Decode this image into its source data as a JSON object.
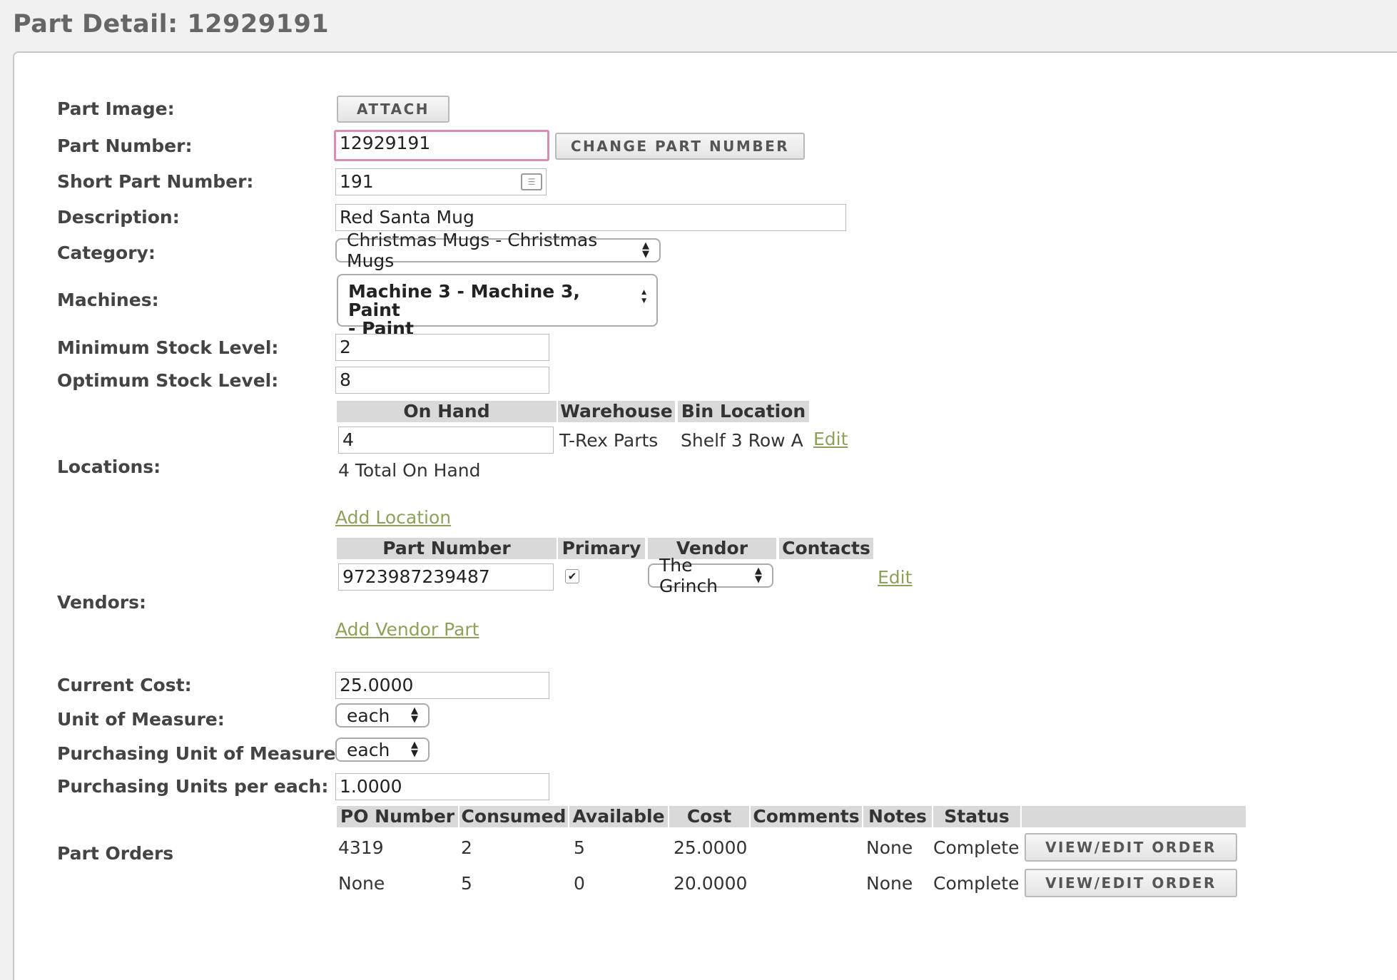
{
  "page_title": "Part Detail: 12929191",
  "labels": {
    "part_image": "Part Image:",
    "part_number": "Part Number:",
    "short_part_number": "Short Part Number:",
    "description": "Description:",
    "category": "Category:",
    "machines": "Machines:",
    "min_stock": "Minimum Stock Level:",
    "opt_stock": "Optimum Stock Level:",
    "locations": "Locations:",
    "vendors": "Vendors:",
    "current_cost": "Current Cost:",
    "unit_of_measure": "Unit of Measure:",
    "purchasing_unit": "Purchasing Unit of Measure:",
    "purchasing_units_per": "Purchasing Units per each:",
    "part_orders": "Part Orders"
  },
  "buttons": {
    "attach": "ATTACH",
    "change_part_number": "CHANGE PART NUMBER",
    "view_edit_order": "VIEW/EDIT ORDER"
  },
  "fields": {
    "part_number": "12929191",
    "short_part_number": "191",
    "description": "Red Santa Mug",
    "category": "Christmas Mugs - Christmas Mugs",
    "machines_line1": "Machine 3 - Machine 3, Paint",
    "machines_line2": "- Paint",
    "min_stock": "2",
    "opt_stock": "8",
    "current_cost": "25.0000",
    "unit_of_measure": "each",
    "purchasing_unit": "each",
    "purchasing_units_per": "1.0000"
  },
  "locations": {
    "headers": [
      "On Hand",
      "Warehouse",
      "Bin Location"
    ],
    "rows": [
      {
        "on_hand": "4",
        "warehouse": "T-Rex Parts",
        "bin": "Shelf 3 Row A",
        "edit": "Edit"
      }
    ],
    "total": "4 Total On Hand",
    "add_link": "Add Location"
  },
  "vendors": {
    "headers": [
      "Part Number",
      "Primary",
      "Vendor",
      "Contacts"
    ],
    "rows": [
      {
        "part_number": "9723987239487",
        "primary": true,
        "vendor": "The Grinch",
        "edit": "Edit"
      }
    ],
    "add_link": "Add Vendor Part"
  },
  "orders": {
    "headers": [
      "PO Number",
      "Consumed",
      "Available",
      "Cost",
      "Comments",
      "Notes",
      "Status"
    ],
    "rows": [
      {
        "po": "4319",
        "consumed": "2",
        "available": "5",
        "cost": "25.0000",
        "comments": "",
        "notes": "None",
        "status": "Complete"
      },
      {
        "po": "None",
        "consumed": "5",
        "available": "0",
        "cost": "20.0000",
        "comments": "",
        "notes": "None",
        "status": "Complete"
      }
    ]
  },
  "colors": {
    "link": "#8da15a",
    "focus_border": "#d98cb4",
    "header_bg": "#d9d9d9"
  }
}
